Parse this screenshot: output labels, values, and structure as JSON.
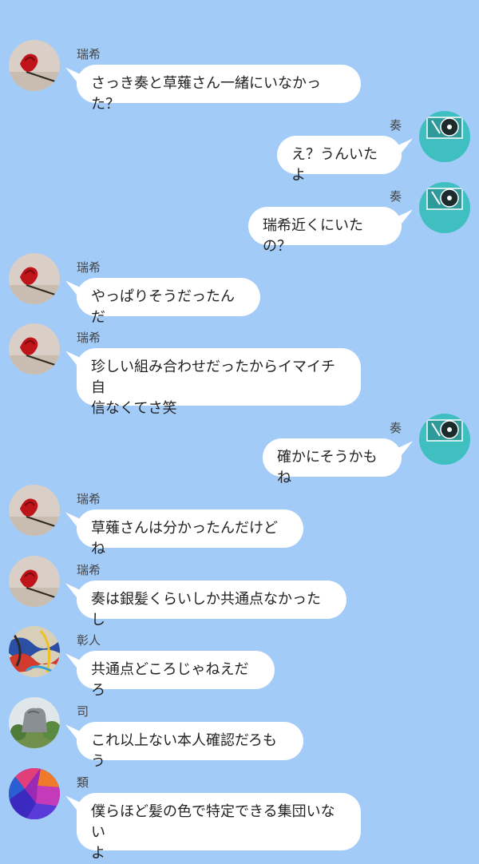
{
  "colors": {
    "background": "#a3cbf7",
    "bubble": "#ffffff",
    "kanade_avatar": "#3fbfbf"
  },
  "messages": [
    {
      "sender": "瑞希",
      "side": "left",
      "avatar": "red-flower-avatar",
      "text": "さっき奏と草薙さん一緒にいなかった？"
    },
    {
      "sender": "奏",
      "side": "right",
      "avatar": "turntable-avatar",
      "text": "え？うんいたよ"
    },
    {
      "sender": "奏",
      "side": "right",
      "avatar": "turntable-avatar",
      "text": "瑞希近くにいたの？"
    },
    {
      "sender": "瑞希",
      "side": "left",
      "avatar": "red-flower-avatar",
      "text": "やっぱりそうだったんだ"
    },
    {
      "sender": "瑞希",
      "side": "left",
      "avatar": "red-flower-avatar",
      "text": "珍しい組み合わせだったからイマイチ自\n信なくてさ笑"
    },
    {
      "sender": "奏",
      "side": "right",
      "avatar": "turntable-avatar",
      "text": "確かにそうかもね"
    },
    {
      "sender": "瑞希",
      "side": "left",
      "avatar": "red-flower-avatar",
      "text": "草薙さんは分かったんだけどね"
    },
    {
      "sender": "瑞希",
      "side": "left",
      "avatar": "red-flower-avatar",
      "text": "奏は銀髪くらいしか共通点なかったし"
    },
    {
      "sender": "彰人",
      "side": "left",
      "avatar": "graffiti-avatar",
      "text": "共通点どころじゃねえだろ"
    },
    {
      "sender": "司",
      "side": "left",
      "avatar": "statue-avatar",
      "text": "これ以上ない本人確認だろもう"
    },
    {
      "sender": "類",
      "side": "left",
      "avatar": "colorful-sphere-avatar",
      "text": "僕らほど髪の色で特定できる集団いない\nよ"
    }
  ]
}
